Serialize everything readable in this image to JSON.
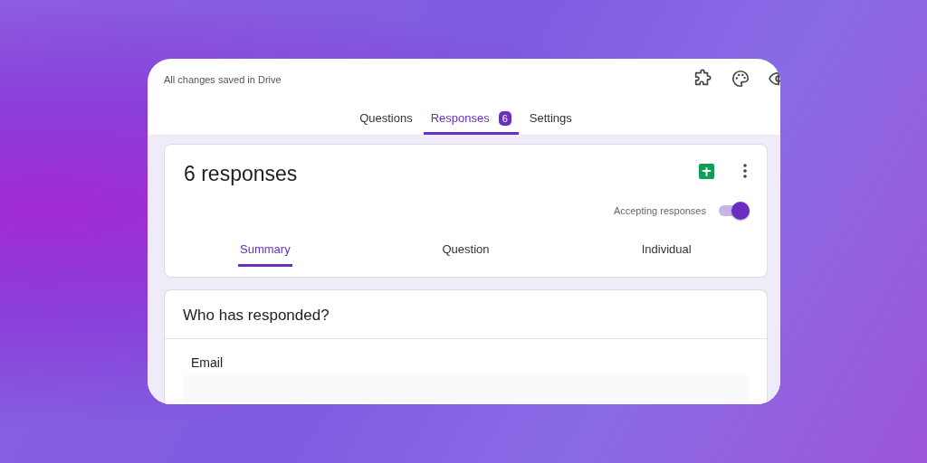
{
  "header": {
    "status": "All changes saved in Drive"
  },
  "tabs": [
    {
      "label": "Questions",
      "selected": false
    },
    {
      "label": "Responses",
      "selected": true,
      "badge": "6"
    },
    {
      "label": "Settings",
      "selected": false
    }
  ],
  "summary": {
    "title": "6 responses",
    "accepting": {
      "label": "Accepting responses",
      "on": true
    },
    "views": [
      {
        "label": "Summary",
        "selected": true
      },
      {
        "label": "Question",
        "selected": false
      },
      {
        "label": "Individual",
        "selected": false
      }
    ]
  },
  "respondents": {
    "title": "Who has responded?",
    "field_label": "Email"
  }
}
